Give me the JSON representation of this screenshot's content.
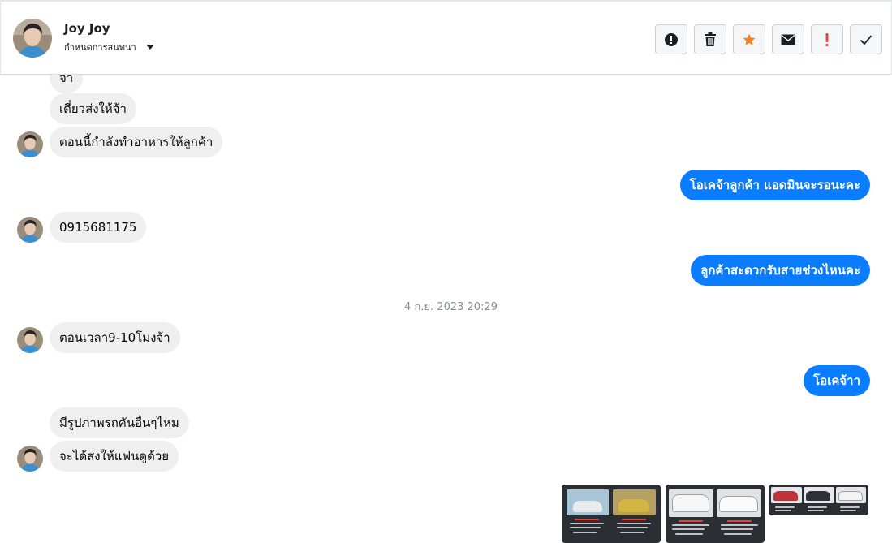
{
  "header": {
    "contact_name": "Joy Joy",
    "subtitle": "กำหนดการสนทนา"
  },
  "actions": [
    {
      "icon": "alert-circle-icon",
      "color": "#1c1e21"
    },
    {
      "icon": "trash-icon",
      "color": "#1c1e21"
    },
    {
      "icon": "star-icon",
      "color": "#f5821f"
    },
    {
      "icon": "envelope-icon",
      "color": "#1c1e21"
    },
    {
      "icon": "exclamation-icon",
      "color": "#e0443c"
    },
    {
      "icon": "check-icon",
      "color": "#1c1e21"
    }
  ],
  "messages": {
    "m0": "จ้า",
    "m1": "เดี๋ยวส่งให้จ้า",
    "m2": "ตอนนี้กำลังทำอาหารให้ลูกค้า",
    "m3": "โอเคจ้าลูกค้า แอดมินจะรอนะคะ",
    "m4": "0915681175",
    "m5": "ลูกค้าสะดวกรับสายช่วงไหนคะ",
    "timestamp": "4 ก.ย. 2023 20:29",
    "m6": "ตอนเวลา9-10โมงจ้า",
    "m7": "โอเคจ้าา",
    "m8": "มีรูปภาพรถคันอื่นๆไหม",
    "m9": "จะได้ส่งให้แฟนดูด้วย"
  },
  "colors": {
    "outgoing_bubble": "#0a7cff",
    "incoming_bubble": "#efefef"
  }
}
